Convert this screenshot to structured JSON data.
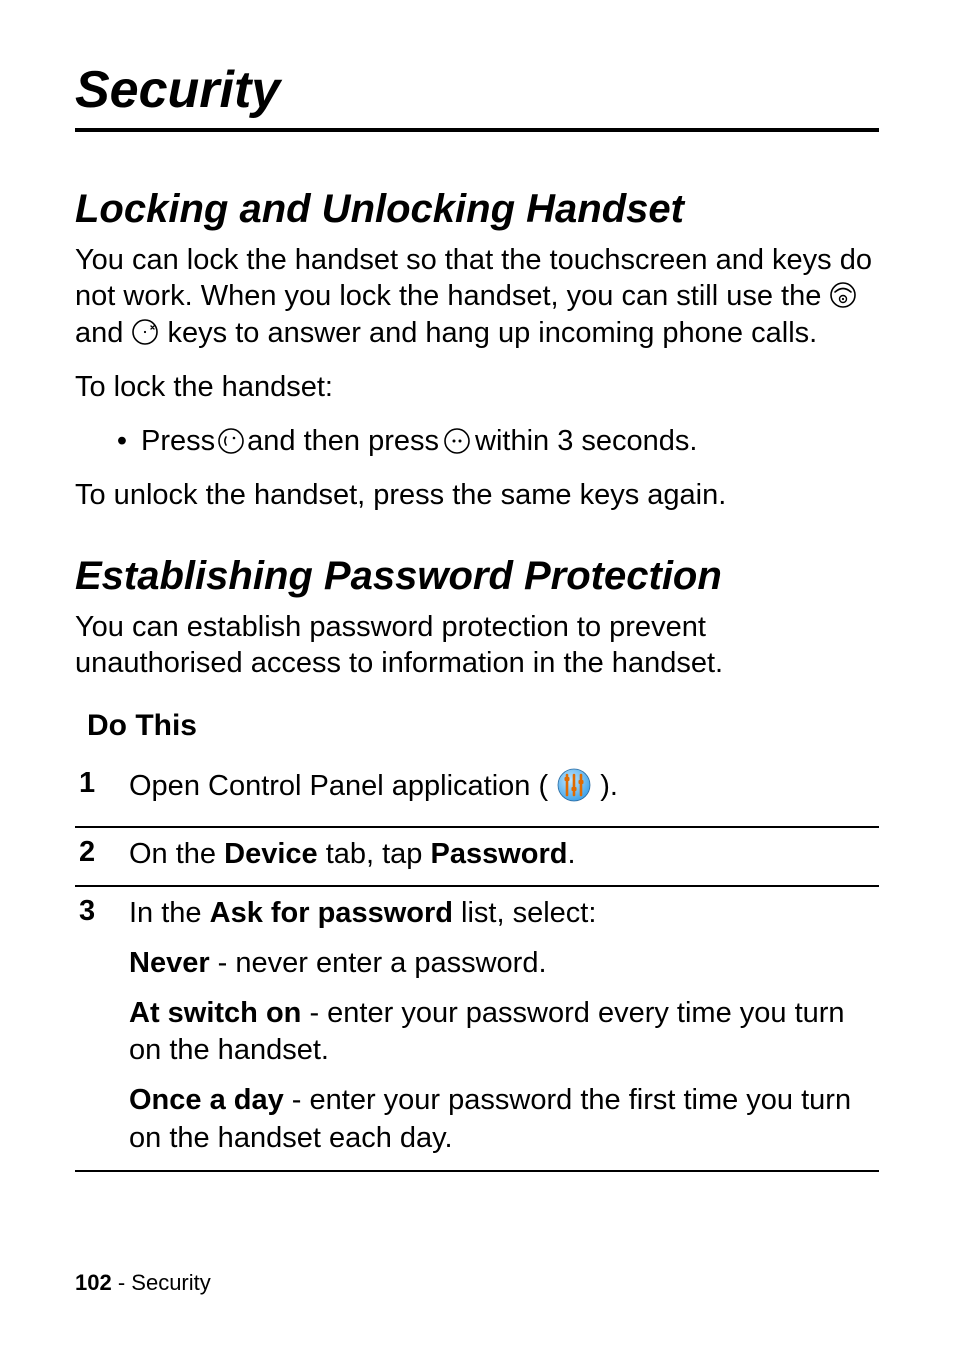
{
  "chapter": {
    "title": "Security"
  },
  "sections": {
    "lock": {
      "title": "Locking and Unlocking Handset",
      "p1_a": "You can lock the handset so that the touchscreen and keys do not work. When you lock the handset, you can still use the ",
      "p1_b": " and ",
      "p1_c": " keys to answer and hang up incoming phone calls.",
      "p2": "To lock the handset:",
      "bullet_a": "Press ",
      "bullet_b": " and then press ",
      "bullet_c": " within 3 seconds.",
      "p3": "To unlock the handset, press the same keys again."
    },
    "password": {
      "title": "Establishing Password Protection",
      "p1": "You can establish password protection to prevent unauthorised access to information in the handset."
    }
  },
  "table": {
    "header": "Do This",
    "steps": [
      {
        "num": "1",
        "text_a": "Open Control Panel application ( ",
        "text_b": " )."
      },
      {
        "num": "2",
        "t1": "On the ",
        "b1": "Device",
        "t2": " tab, tap ",
        "b2": "Password",
        "t3": "."
      },
      {
        "num": "3",
        "intro_a": "In the ",
        "intro_b": "Ask for password",
        "intro_c": " list, select:",
        "opt1_b": "Never",
        "opt1_t": " - never enter a password.",
        "opt2_b": "At switch on",
        "opt2_t": " - enter your password every time you turn on the handset.",
        "opt3_b": "Once a day",
        "opt3_t": " - enter your password the first time you turn on the handset each day."
      }
    ]
  },
  "footer": {
    "page": "102",
    "sep": " - ",
    "name": "Security"
  },
  "icons": {
    "bullet": "•"
  }
}
